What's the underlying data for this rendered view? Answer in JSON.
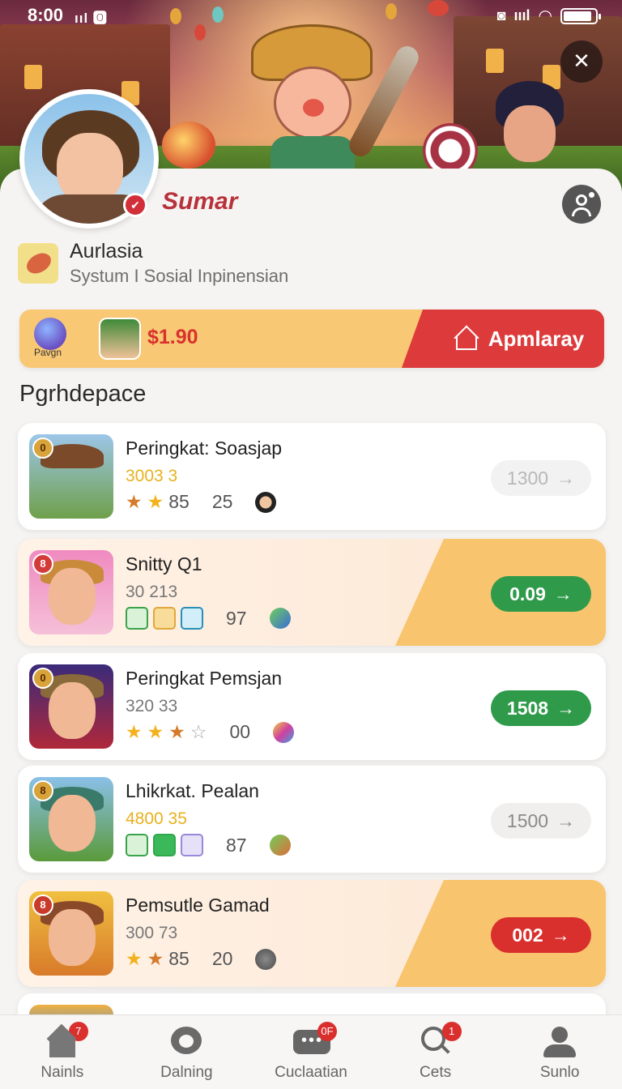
{
  "status_bar": {
    "time": "8:00",
    "left_indicators": "ııl 🅾"
  },
  "profile": {
    "username": "Sumar",
    "org_title": "Aurlasia",
    "org_subtitle": "Systum I Sosial Inpinensian"
  },
  "balance": {
    "coin_label": "Pavgn",
    "amount": "$1.90",
    "action_label": "Apmlaray"
  },
  "section_title": "Pgrhdepace",
  "list_items": [
    {
      "title": "Peringkat: Soasjap",
      "sub": "3003 3",
      "stat1": "85",
      "stat2": "25",
      "button": "1300",
      "button_style": "light",
      "highlight": false
    },
    {
      "title": "Snitty Q1",
      "sub": "30 213",
      "stat1": "97",
      "button": "0.09",
      "button_style": "green",
      "highlight": true
    },
    {
      "title": "Peringkat Pemsjan",
      "sub": "320 33",
      "stat1": "00",
      "button": "1508",
      "button_style": "green",
      "highlight": false
    },
    {
      "title": "Lhikrkat. Pealan",
      "sub": "4800 35",
      "stat1": "87",
      "button": "1500",
      "button_style": "mid",
      "highlight": false
    },
    {
      "title": "Pemsutle Gamad",
      "sub": "300 73",
      "stat1": "85",
      "stat2": "20",
      "button": "002",
      "button_style": "red",
      "highlight": true
    }
  ],
  "bottom_nav": [
    {
      "label": "Nainls",
      "badge": "7"
    },
    {
      "label": "Dalning",
      "badge": ""
    },
    {
      "label": "Cuclaatian",
      "badge": "0F"
    },
    {
      "label": "Cets",
      "badge": "1"
    },
    {
      "label": "Sunlo",
      "badge": ""
    }
  ]
}
